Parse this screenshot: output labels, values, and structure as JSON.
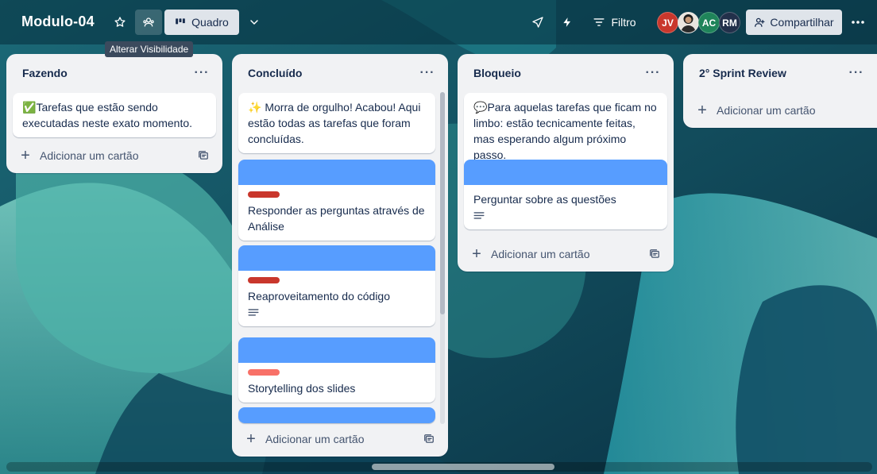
{
  "header": {
    "board_title": "Modulo-04",
    "view_label": "Quadro",
    "visibility_tooltip": "Alterar Visibilidade",
    "filter_label": "Filtro",
    "share_label": "Compartilhar",
    "members": [
      {
        "initials": "JV",
        "color": "#c9372c"
      },
      {
        "initials": "",
        "color": "#e9e5df"
      },
      {
        "initials": "AC",
        "color": "#1f845a"
      },
      {
        "initials": "RM",
        "color": "#22304a"
      }
    ]
  },
  "lists": [
    {
      "title": "Fazendo",
      "cards": [
        {
          "emoji": "✅",
          "text": "Tarefas que estão sendo executadas neste exato momento."
        }
      ],
      "add_label": "Adicionar um cartão"
    },
    {
      "title": "Concluído",
      "cards": [
        {
          "emoji": "✨",
          "text": " Morra de orgulho! Acabou! Aqui estão todas as tarefas que foram concluídas."
        },
        {
          "text": "Responder as perguntas através de Análise",
          "label_color": "#c9372c",
          "cover_color": "#579dff",
          "has_description": false
        },
        {
          "text": "Reaproveitamento do código",
          "label_color": "#c9372c",
          "cover_color": "#579dff",
          "has_description": true
        },
        {
          "text": "Storytelling dos slides",
          "label_color": "#f87168",
          "cover_color": "#579dff",
          "has_description": false
        }
      ],
      "add_label": "Adicionar um cartão"
    },
    {
      "title": "Bloqueio",
      "cards": [
        {
          "emoji": "💬",
          "text": "Para aquelas tarefas que ficam no limbo: estão tecnicamente feitas, mas esperando algum próximo passo."
        },
        {
          "text": "Perguntar sobre as questões",
          "cover_color": "#579dff",
          "has_description": true
        }
      ],
      "add_label": "Adicionar um cartão"
    },
    {
      "title": "2° Sprint Review",
      "cards": [],
      "add_label": "Adicionar um cartão"
    }
  ],
  "colors": {
    "accent_blue": "#579dff",
    "label_red": "#c9372c",
    "label_light_red": "#f87168",
    "list_bg": "#f1f2f4"
  }
}
